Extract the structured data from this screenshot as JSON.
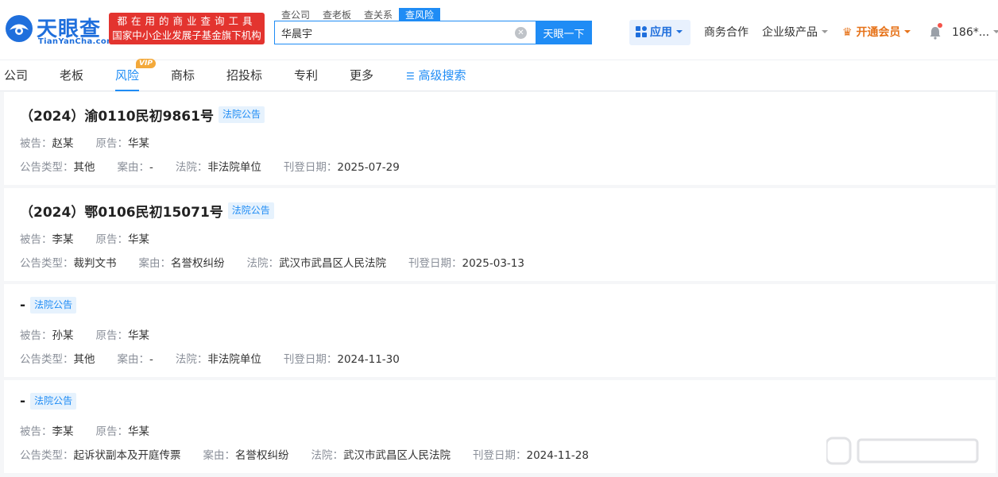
{
  "header": {
    "logo_cn": "天眼查",
    "logo_en": "TianYanCha.com",
    "slogan_line1": "都在用的商业查询工具",
    "slogan_line2": "国家中小企业发展子基金旗下机构",
    "search_tabs": [
      "查公司",
      "查老板",
      "查关系",
      "查风险"
    ],
    "search_value": "华晨宇",
    "search_button": "天眼一下",
    "app_label": "应用",
    "business": "商务合作",
    "enterprise": "企业级产品",
    "vip": "开通会员",
    "user": "186*..."
  },
  "tabs": {
    "items": [
      "公司",
      "老板",
      "风险",
      "商标",
      "招投标",
      "专利",
      "更多"
    ],
    "vip_badge": "VIP",
    "advanced": "高级搜索"
  },
  "labels": {
    "defendant": "被告：",
    "plaintiff": "原告：",
    "type": "公告类型：",
    "cause": "案由：",
    "court": "法院：",
    "date": "刊登日期："
  },
  "cards": [
    {
      "title": "（2024）渝0110民初9861号",
      "tag": "法院公告",
      "defendant": "赵某",
      "plaintiff": "华某",
      "type": "其他",
      "cause": "-",
      "court": "非法院单位",
      "date": "2025-07-29"
    },
    {
      "title": "（2024）鄂0106民初15071号",
      "tag": "法院公告",
      "defendant": "李某",
      "plaintiff": "华某",
      "type": "裁判文书",
      "cause": "名誉权纠纷",
      "court": "武汉市武昌区人民法院",
      "date": "2025-03-13"
    },
    {
      "title": "-",
      "tag": "法院公告",
      "defendant": "孙某",
      "plaintiff": "华某",
      "type": "其他",
      "cause": "-",
      "court": "非法院单位",
      "date": "2024-11-30"
    },
    {
      "title": "-",
      "tag": "法院公告",
      "defendant": "李某",
      "plaintiff": "华某",
      "type": "起诉状副本及开庭传票",
      "cause": "名誉权纠纷",
      "court": "武汉市武昌区人民法院",
      "date": "2024-11-28"
    }
  ],
  "colors": {
    "brand": "#1f8cf5",
    "logo": "#1f6fdc",
    "slogan_bg": "#e3342f",
    "vip": "#e6731a"
  }
}
